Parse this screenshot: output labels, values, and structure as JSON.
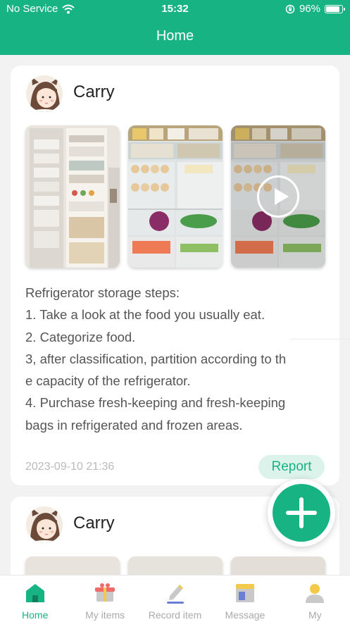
{
  "status_bar": {
    "carrier": "No Service",
    "time": "15:32",
    "battery": "96%",
    "battery_level": 0.96,
    "wifi_icon": "wifi-icon",
    "lock_icon": "orientation-lock-icon"
  },
  "header": {
    "title": "Home"
  },
  "posts": [
    {
      "username": "Carry",
      "avatar_icon": "girl-avatar",
      "images": [
        "fridge-door-photo",
        "fridge-drawers-photo",
        "fridge-video-thumbnail"
      ],
      "description": [
        "Refrigerator storage steps:",
        "1. Take a look at the food you usually eat.",
        "2. Categorize food.",
        "3, after classification, partition according to th",
        "e capacity of the refrigerator.",
        "4. Purchase fresh-keeping and fresh-keeping",
        "bags in refrigerated and frozen areas."
      ],
      "timestamp": "2023-09-10 21:36",
      "report_label": "Report"
    },
    {
      "username": "Carry",
      "avatar_icon": "girl-avatar"
    }
  ],
  "tabs": [
    {
      "label": "Home",
      "icon": "home-icon",
      "active": true
    },
    {
      "label": "My items",
      "icon": "items-box-icon",
      "active": false
    },
    {
      "label": "Record item",
      "icon": "pencil-record-icon",
      "active": false
    },
    {
      "label": "Message",
      "icon": "message-icon",
      "active": false
    },
    {
      "label": "My",
      "icon": "user-icon",
      "active": false
    }
  ],
  "colors": {
    "brand": "#17b383",
    "report_bg": "#dcf3ec",
    "inactive": "#aaaaaa"
  }
}
